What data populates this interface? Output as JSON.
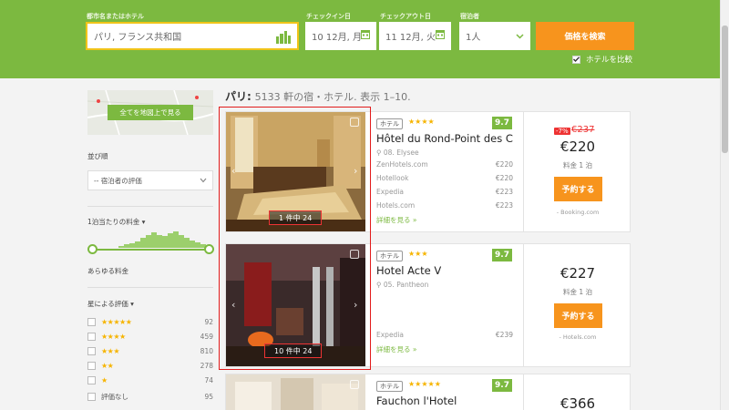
{
  "search": {
    "destination_label": "都市名またはホテル",
    "destination_value": "パリ, フランス共和国",
    "checkin_label": "チェックイン日",
    "checkin_value": "10 12月, 月",
    "checkout_label": "チェックアウト日",
    "checkout_value": "11 12月, 火",
    "guests_label": "宿泊者",
    "guests_value": "1人",
    "search_button": "価格を検索",
    "compare_label": "ホテルを比較"
  },
  "sidebar": {
    "map_button": "全てを地図上で見る",
    "sort_label": "並び順",
    "sort_value": "-- 宿泊者の評価",
    "price_label": "1泊当たりの料金",
    "price_any": "あらゆる料金",
    "price_histogram": [
      2,
      3,
      4,
      6,
      9,
      12,
      14,
      12,
      11,
      13,
      15,
      12,
      9,
      7,
      5,
      3
    ],
    "stars_label": "星による評価",
    "star_filters": [
      {
        "stars": "★★★★★",
        "count": "92"
      },
      {
        "stars": "★★★★",
        "count": "459"
      },
      {
        "stars": "★★★",
        "count": "810"
      },
      {
        "stars": "★★",
        "count": "278"
      },
      {
        "stars": "★",
        "count": "74"
      },
      {
        "stars": "評価なし",
        "count": "95"
      }
    ]
  },
  "results": {
    "city": "パリ:",
    "summary": "5133 軒の宿・ホテル. 表示 1–10."
  },
  "hotels": [
    {
      "photo_counter": "1 件中 24",
      "type": "ホテル",
      "stars": "★★★★",
      "score": "9.7",
      "name": "Hôtel du Rond-Point des C...",
      "location": "08. Elysee",
      "providers": [
        {
          "name": "ZenHotels.com",
          "price": "€220"
        },
        {
          "name": "Hotellook",
          "price": "€220"
        },
        {
          "name": "Expedia",
          "price": "€223"
        },
        {
          "name": "Hotels.com",
          "price": "€223"
        }
      ],
      "more": "詳細を見る »",
      "discount": "-7%",
      "old_price": "€237",
      "price": "€220",
      "per_night": "料金 1 泊",
      "book": "予約する",
      "source": "- Booking.com"
    },
    {
      "photo_counter": "10 件中 24",
      "type": "ホテル",
      "stars": "★★★",
      "score": "9.7",
      "name": "Hotel Acte V",
      "location": "05. Pantheon",
      "providers": [
        {
          "name": "Expedia",
          "price": "€239"
        }
      ],
      "more": "詳細を見る »",
      "price": "€227",
      "per_night": "料金 1 泊",
      "book": "予約する",
      "source": "- Hotels.com"
    },
    {
      "type": "ホテル",
      "stars": "★★★★★",
      "score": "9.7",
      "name": "Fauchon l'Hotel",
      "price": "€366"
    }
  ],
  "colors": {
    "brand_green": "#7cb940",
    "accent_orange": "#f7941d",
    "highlight_red": "#e21b1b"
  }
}
